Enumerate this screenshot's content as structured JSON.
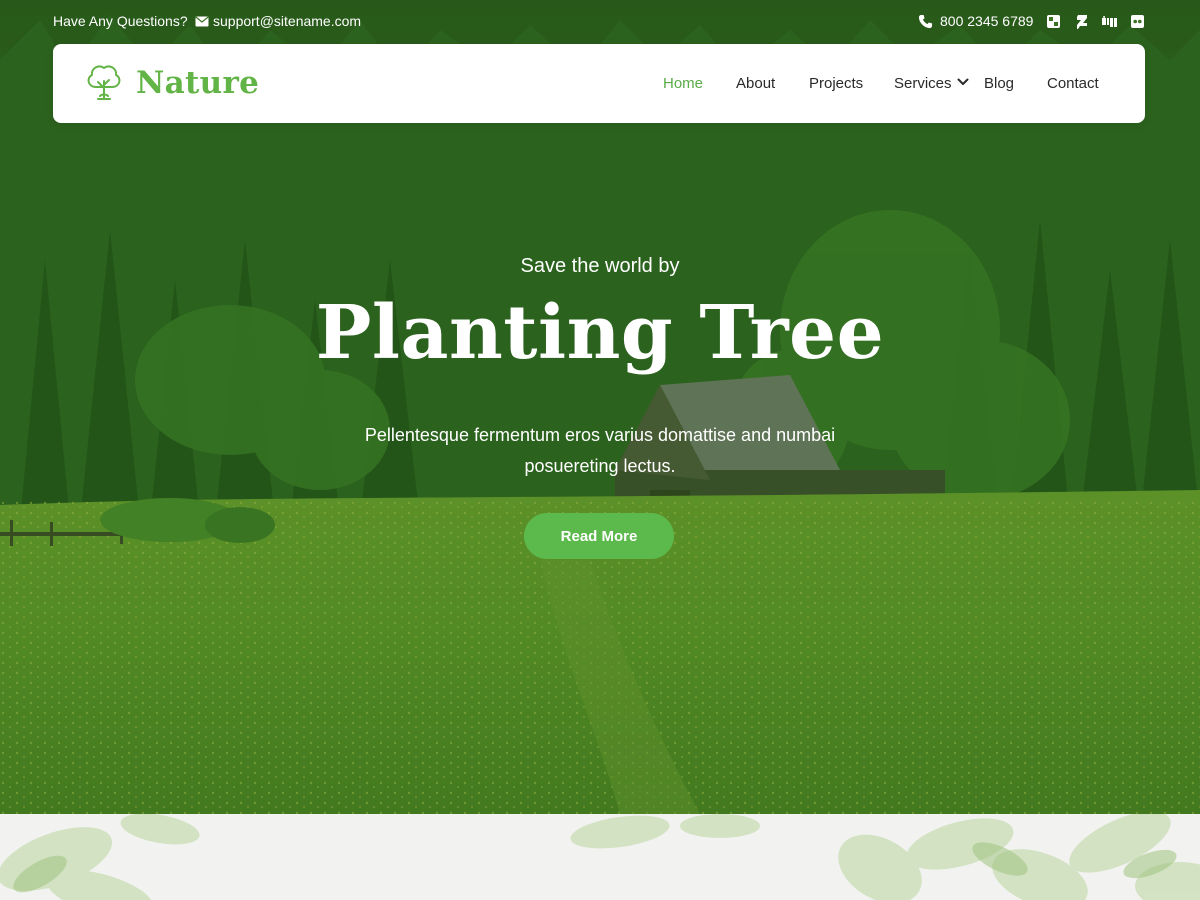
{
  "topbar": {
    "question": "Have Any Questions?",
    "email": "support@sitename.com",
    "phone": "800 2345 6789",
    "social_icons": [
      "vk-icon",
      "deviantart-icon",
      "digg-icon",
      "flickr-icon"
    ]
  },
  "navbar": {
    "logo_text": "Nature",
    "items": [
      {
        "label": "Home",
        "active": true
      },
      {
        "label": "About"
      },
      {
        "label": "Projects"
      },
      {
        "label": "Services"
      },
      {
        "label": "Blog"
      },
      {
        "label": "Contact"
      }
    ]
  },
  "hero": {
    "subtitle": "Save the world by",
    "title": "Planting Tree",
    "description": "Pellentesque fermentum eros varius domattise and numbai posuereting lectus.",
    "button_label": "Read More"
  },
  "colors": {
    "accent": "#5cb94b",
    "logo": "#63b446",
    "hero_overlay": "#2f6a1f"
  }
}
